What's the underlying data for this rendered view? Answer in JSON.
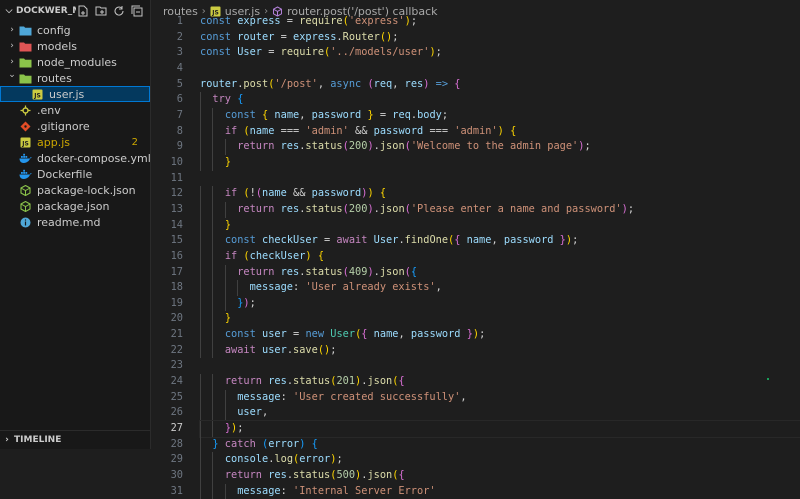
{
  "explorer": {
    "title": "DOCKWER_M...",
    "items": [
      {
        "label": "config",
        "kind": "folder",
        "icon": "config-folder-icon",
        "icon_color": "#4fa7d8",
        "expanded": false
      },
      {
        "label": "models",
        "kind": "folder",
        "icon": "models-folder-icon",
        "icon_color": "#e05555",
        "expanded": false
      },
      {
        "label": "node_modules",
        "kind": "folder",
        "icon": "node-modules-folder-icon",
        "icon_color": "#8bc34a",
        "expanded": false
      },
      {
        "label": "routes",
        "kind": "folder",
        "icon": "routes-folder-icon",
        "icon_color": "#8bc34a",
        "expanded": true
      },
      {
        "label": "user.js",
        "kind": "file",
        "icon": "js-file-icon",
        "icon_color": "#cbcb41",
        "selected": true,
        "indent": 1
      },
      {
        "label": ".env",
        "kind": "file",
        "icon": "env-file-icon",
        "icon_color": "#cbcb41"
      },
      {
        "label": ".gitignore",
        "kind": "file",
        "icon": "git-icon",
        "icon_color": "#e44d26"
      },
      {
        "label": "app.js",
        "kind": "file",
        "icon": "js-file-icon",
        "icon_color": "#cbcb41",
        "badge": "2",
        "warning": true
      },
      {
        "label": "docker-compose.yml",
        "kind": "file",
        "icon": "docker-icon",
        "icon_color": "#2496ed"
      },
      {
        "label": "Dockerfile",
        "kind": "file",
        "icon": "docker-icon",
        "icon_color": "#2496ed"
      },
      {
        "label": "package-lock.json",
        "kind": "file",
        "icon": "npm-package-icon",
        "icon_color": "#8bc34a"
      },
      {
        "label": "package.json",
        "kind": "file",
        "icon": "npm-package-icon",
        "icon_color": "#8bc34a"
      },
      {
        "label": "readme.md",
        "kind": "file",
        "icon": "info-icon",
        "icon_color": "#4fa7d8"
      }
    ]
  },
  "timeline": {
    "title": "TIMELINE"
  },
  "breadcrumb": {
    "folder": "routes",
    "file": "user.js",
    "symbol": "router.post('/post') callback"
  },
  "editor": {
    "first_line": 1,
    "current_line": 27,
    "lines": [
      {
        "i": 0,
        "t": [
          [
            "kw",
            "const "
          ],
          [
            "vr",
            "express"
          ],
          [
            "pun",
            " = "
          ],
          [
            "fn",
            "require"
          ],
          [
            "b1",
            "("
          ],
          [
            "str",
            "'express'"
          ],
          [
            "b1",
            ")"
          ],
          [
            "pun",
            ";"
          ]
        ]
      },
      {
        "i": 0,
        "t": [
          [
            "kw",
            "const "
          ],
          [
            "vr",
            "router"
          ],
          [
            "pun",
            " = "
          ],
          [
            "vr",
            "express"
          ],
          [
            "pun",
            "."
          ],
          [
            "fn",
            "Router"
          ],
          [
            "b1",
            "()"
          ],
          [
            "pun",
            ";"
          ]
        ]
      },
      {
        "i": 0,
        "t": [
          [
            "kw",
            "const "
          ],
          [
            "vr",
            "User"
          ],
          [
            "pun",
            " = "
          ],
          [
            "fn",
            "require"
          ],
          [
            "b1",
            "("
          ],
          [
            "str",
            "'../models/user'"
          ],
          [
            "b1",
            ")"
          ],
          [
            "pun",
            ";"
          ]
        ]
      },
      {
        "i": 0,
        "t": []
      },
      {
        "i": 0,
        "t": [
          [
            "vr",
            "router"
          ],
          [
            "pun",
            "."
          ],
          [
            "fn",
            "post"
          ],
          [
            "b1",
            "("
          ],
          [
            "str",
            "'/post'"
          ],
          [
            "pun",
            ", "
          ],
          [
            "kw",
            "async "
          ],
          [
            "b2",
            "("
          ],
          [
            "vr",
            "req"
          ],
          [
            "pun",
            ", "
          ],
          [
            "vr",
            "res"
          ],
          [
            "b2",
            ")"
          ],
          [
            "kw",
            " => "
          ],
          [
            "b2",
            "{"
          ]
        ]
      },
      {
        "i": 1,
        "t": [
          [
            "ctl",
            "try "
          ],
          [
            "b3",
            "{"
          ]
        ]
      },
      {
        "i": 2,
        "t": [
          [
            "kw",
            "const "
          ],
          [
            "b1",
            "{ "
          ],
          [
            "vr",
            "name"
          ],
          [
            "pun",
            ", "
          ],
          [
            "vr",
            "password"
          ],
          [
            "b1",
            " }"
          ],
          [
            "pun",
            " = "
          ],
          [
            "vr",
            "req"
          ],
          [
            "pun",
            "."
          ],
          [
            "vr",
            "body"
          ],
          [
            "pun",
            ";"
          ]
        ]
      },
      {
        "i": 2,
        "t": [
          [
            "ctl",
            "if "
          ],
          [
            "b1",
            "("
          ],
          [
            "vr",
            "name"
          ],
          [
            "pun",
            " === "
          ],
          [
            "str",
            "'admin'"
          ],
          [
            "pun",
            " && "
          ],
          [
            "vr",
            "password"
          ],
          [
            "pun",
            " === "
          ],
          [
            "str",
            "'admin'"
          ],
          [
            "b1",
            ")"
          ],
          [
            "pun",
            " "
          ],
          [
            "b1",
            "{"
          ]
        ]
      },
      {
        "i": 3,
        "t": [
          [
            "ctl",
            "return "
          ],
          [
            "vr",
            "res"
          ],
          [
            "pun",
            "."
          ],
          [
            "fn",
            "status"
          ],
          [
            "b2",
            "("
          ],
          [
            "num",
            "200"
          ],
          [
            "b2",
            ")"
          ],
          [
            "pun",
            "."
          ],
          [
            "fn",
            "json"
          ],
          [
            "b2",
            "("
          ],
          [
            "str",
            "'Welcome to the admin page'"
          ],
          [
            "b2",
            ")"
          ],
          [
            "pun",
            ";"
          ]
        ]
      },
      {
        "i": 2,
        "t": [
          [
            "b1",
            "}"
          ]
        ]
      },
      {
        "i": 0,
        "t": []
      },
      {
        "i": 2,
        "t": [
          [
            "ctl",
            "if "
          ],
          [
            "b1",
            "("
          ],
          [
            "pun",
            "!"
          ],
          [
            "b2",
            "("
          ],
          [
            "vr",
            "name"
          ],
          [
            "pun",
            " && "
          ],
          [
            "vr",
            "password"
          ],
          [
            "b2",
            ")"
          ],
          [
            "b1",
            ")"
          ],
          [
            "pun",
            " "
          ],
          [
            "b1",
            "{"
          ]
        ]
      },
      {
        "i": 3,
        "t": [
          [
            "ctl",
            "return "
          ],
          [
            "vr",
            "res"
          ],
          [
            "pun",
            "."
          ],
          [
            "fn",
            "status"
          ],
          [
            "b2",
            "("
          ],
          [
            "num",
            "200"
          ],
          [
            "b2",
            ")"
          ],
          [
            "pun",
            "."
          ],
          [
            "fn",
            "json"
          ],
          [
            "b2",
            "("
          ],
          [
            "str",
            "'Please enter a name and password'"
          ],
          [
            "b2",
            ")"
          ],
          [
            "pun",
            ";"
          ]
        ]
      },
      {
        "i": 2,
        "t": [
          [
            "b1",
            "}"
          ]
        ]
      },
      {
        "i": 2,
        "t": [
          [
            "kw",
            "const "
          ],
          [
            "vr",
            "checkUser"
          ],
          [
            "pun",
            " = "
          ],
          [
            "ctl",
            "await "
          ],
          [
            "vr",
            "User"
          ],
          [
            "pun",
            "."
          ],
          [
            "fn",
            "findOne"
          ],
          [
            "b1",
            "("
          ],
          [
            "b2",
            "{ "
          ],
          [
            "vr",
            "name"
          ],
          [
            "pun",
            ", "
          ],
          [
            "vr",
            "password"
          ],
          [
            "b2",
            " }"
          ],
          [
            "b1",
            ")"
          ],
          [
            "pun",
            ";"
          ]
        ]
      },
      {
        "i": 2,
        "t": [
          [
            "ctl",
            "if "
          ],
          [
            "b1",
            "("
          ],
          [
            "vr",
            "checkUser"
          ],
          [
            "b1",
            ")"
          ],
          [
            "pun",
            " "
          ],
          [
            "b1",
            "{"
          ]
        ]
      },
      {
        "i": 3,
        "t": [
          [
            "ctl",
            "return "
          ],
          [
            "vr",
            "res"
          ],
          [
            "pun",
            "."
          ],
          [
            "fn",
            "status"
          ],
          [
            "b2",
            "("
          ],
          [
            "num",
            "409"
          ],
          [
            "b2",
            ")"
          ],
          [
            "pun",
            "."
          ],
          [
            "fn",
            "json"
          ],
          [
            "b2",
            "("
          ],
          [
            "b3",
            "{"
          ]
        ]
      },
      {
        "i": 4,
        "t": [
          [
            "vr",
            "message"
          ],
          [
            "pun",
            ": "
          ],
          [
            "str",
            "'User already exists'"
          ],
          [
            "pun",
            ","
          ]
        ]
      },
      {
        "i": 3,
        "t": [
          [
            "b3",
            "}"
          ],
          [
            "b2",
            ")"
          ],
          [
            "pun",
            ";"
          ]
        ]
      },
      {
        "i": 2,
        "t": [
          [
            "b1",
            "}"
          ]
        ]
      },
      {
        "i": 2,
        "t": [
          [
            "kw",
            "const "
          ],
          [
            "vr",
            "user"
          ],
          [
            "pun",
            " = "
          ],
          [
            "kw",
            "new "
          ],
          [
            "cls",
            "User"
          ],
          [
            "b1",
            "("
          ],
          [
            "b2",
            "{ "
          ],
          [
            "vr",
            "name"
          ],
          [
            "pun",
            ", "
          ],
          [
            "vr",
            "password"
          ],
          [
            "b2",
            " }"
          ],
          [
            "b1",
            ")"
          ],
          [
            "pun",
            ";"
          ]
        ]
      },
      {
        "i": 2,
        "t": [
          [
            "ctl",
            "await "
          ],
          [
            "vr",
            "user"
          ],
          [
            "pun",
            "."
          ],
          [
            "fn",
            "save"
          ],
          [
            "b1",
            "()"
          ],
          [
            "pun",
            ";"
          ]
        ]
      },
      {
        "i": 0,
        "t": []
      },
      {
        "i": 2,
        "t": [
          [
            "ctl",
            "return "
          ],
          [
            "vr",
            "res"
          ],
          [
            "pun",
            "."
          ],
          [
            "fn",
            "status"
          ],
          [
            "b1",
            "("
          ],
          [
            "num",
            "201"
          ],
          [
            "b1",
            ")"
          ],
          [
            "pun",
            "."
          ],
          [
            "fn",
            "json"
          ],
          [
            "b1",
            "("
          ],
          [
            "b2",
            "{"
          ]
        ]
      },
      {
        "i": 3,
        "t": [
          [
            "vr",
            "message"
          ],
          [
            "pun",
            ": "
          ],
          [
            "str",
            "'User created successfully'"
          ],
          [
            "pun",
            ","
          ]
        ]
      },
      {
        "i": 3,
        "t": [
          [
            "vr",
            "user"
          ],
          [
            "pun",
            ","
          ]
        ]
      },
      {
        "i": 2,
        "t": [
          [
            "b2",
            "}"
          ],
          [
            "b1",
            ")"
          ],
          [
            "pun",
            ";"
          ]
        ]
      },
      {
        "i": 1,
        "t": [
          [
            "b3",
            "}"
          ],
          [
            "ctl",
            " catch "
          ],
          [
            "b3",
            "("
          ],
          [
            "vr",
            "error"
          ],
          [
            "b3",
            ")"
          ],
          [
            "pun",
            " "
          ],
          [
            "b3",
            "{"
          ]
        ]
      },
      {
        "i": 2,
        "t": [
          [
            "vr",
            "console"
          ],
          [
            "pun",
            "."
          ],
          [
            "fn",
            "log"
          ],
          [
            "b1",
            "("
          ],
          [
            "vr",
            "error"
          ],
          [
            "b1",
            ")"
          ],
          [
            "pun",
            ";"
          ]
        ]
      },
      {
        "i": 2,
        "t": [
          [
            "ctl",
            "return "
          ],
          [
            "vr",
            "res"
          ],
          [
            "pun",
            "."
          ],
          [
            "fn",
            "status"
          ],
          [
            "b1",
            "("
          ],
          [
            "num",
            "500"
          ],
          [
            "b1",
            ")"
          ],
          [
            "pun",
            "."
          ],
          [
            "fn",
            "json"
          ],
          [
            "b1",
            "("
          ],
          [
            "b2",
            "{"
          ]
        ]
      },
      {
        "i": 3,
        "t": [
          [
            "vr",
            "message"
          ],
          [
            "pun",
            ": "
          ],
          [
            "str",
            "'Internal Server Error'"
          ]
        ]
      }
    ]
  }
}
